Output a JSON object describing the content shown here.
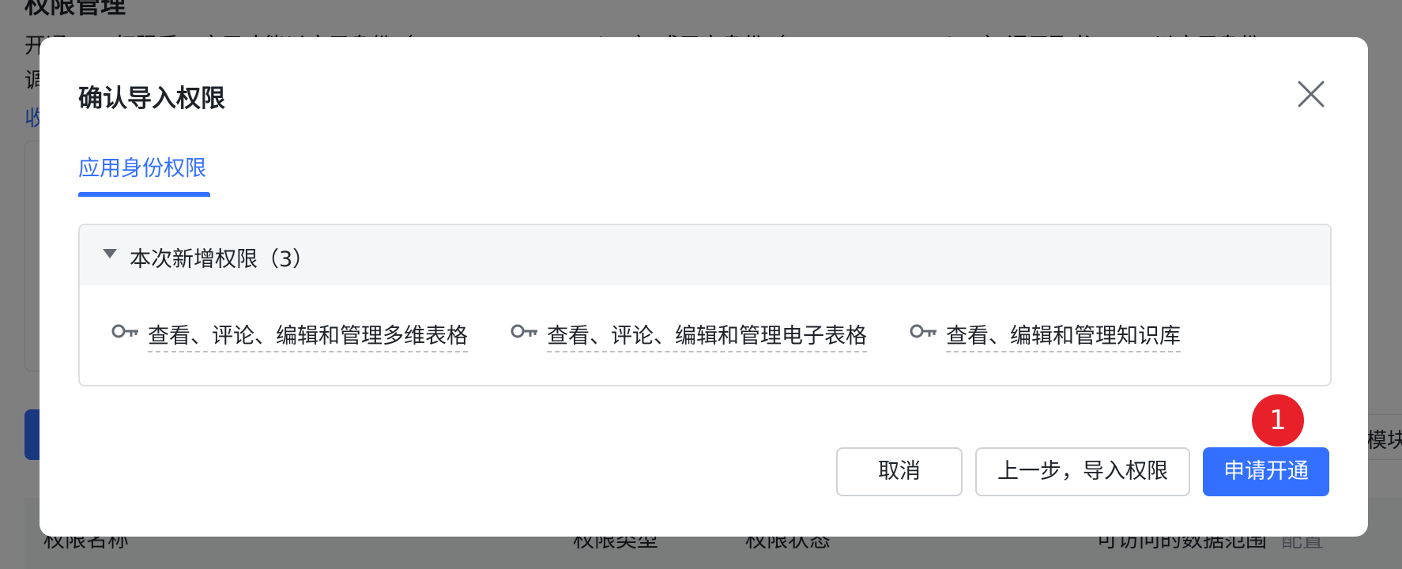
{
  "background": {
    "line1": "开通 API 权限后，应用才能以应用身份（tenant_access_token）或用户身份（user_access_token）调用飞书 API。以应用身份",
    "line2": "调",
    "line3_link": "收",
    "right_button_label": "模块",
    "table_headers": {
      "name": "权限名称",
      "type": "权限类型",
      "status": "权限状态",
      "scope": "可访问的数据范围",
      "config": "配置"
    }
  },
  "modal": {
    "title": "确认导入权限",
    "tabs": [
      {
        "label": "应用身份权限",
        "active": true
      }
    ],
    "section": {
      "title": "本次新增权限（3）",
      "permissions": [
        {
          "label": "查看、评论、编辑和管理多维表格",
          "icon": "key-icon"
        },
        {
          "label": "查看、评论、编辑和管理电子表格",
          "icon": "key-icon"
        },
        {
          "label": "查看、编辑和管理知识库",
          "icon": "key-icon"
        }
      ]
    },
    "buttons": {
      "cancel": "取消",
      "prev": "上一步，导入权限",
      "apply": "申请开通"
    },
    "step_badge": "1"
  },
  "colors": {
    "accent": "#3370ff",
    "badge": "#e8202a",
    "text": "#1f2329",
    "overlay": "rgba(0,0,0,0.5)"
  }
}
